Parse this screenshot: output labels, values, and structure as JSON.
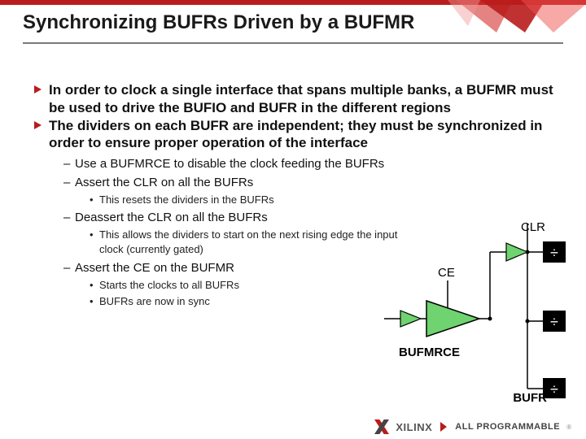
{
  "title": "Synchronizing BUFRs Driven by a BUFMR",
  "bullets": {
    "b1": "In order to clock a single interface that spans multiple banks, a BUFMR must be used to drive the BUFIO and BUFR in the different regions",
    "b2": "The dividers on each BUFR are independent; they must be synchronized in order to ensure proper operation of the interface",
    "sub": {
      "s1": "Use a BUFMRCE to disable the clock feeding the BUFRs",
      "s2": "Assert the CLR on all the BUFRs",
      "s2d1": "This resets the dividers in the BUFRs",
      "s3": "Deassert the CLR on all the BUFRs",
      "s3d1": "This allows the dividers to start on the next rising edge the input clock (currently gated)",
      "s4": "Assert the CE on the BUFMR",
      "s4d1": "Starts the clocks to all BUFRs",
      "s4d2": "BUFRs are now in sync"
    }
  },
  "diagram": {
    "clr": "CLR",
    "ce": "CE",
    "bufmrce": "BUFMRCE",
    "bufr": "BUFR",
    "div": "÷"
  },
  "footer": {
    "brand": "XILINX",
    "tag": "ALL PROGRAMMABLE"
  }
}
